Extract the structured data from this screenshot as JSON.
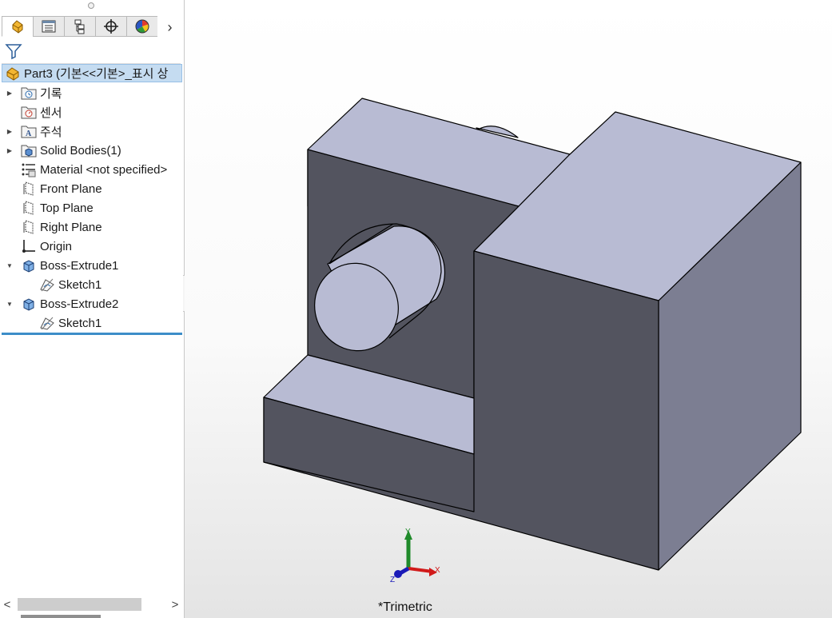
{
  "panel": {
    "tabs": [
      {
        "name": "featuremanager-tab-icon",
        "active": true
      },
      {
        "name": "propertymanager-tab-icon",
        "active": false
      },
      {
        "name": "configurationmanager-tab-icon",
        "active": false
      },
      {
        "name": "dimxpert-tab-icon",
        "active": false
      },
      {
        "name": "display-manager-tab-icon",
        "active": false
      }
    ],
    "more_tabs_glyph": "›",
    "filter_icon": "filter-icon",
    "root": {
      "label": "Part3  (기본<<기본>_표시 상",
      "icon": "part-icon"
    },
    "tree": [
      {
        "label": "기록",
        "icon": "history-icon",
        "expandable": true
      },
      {
        "label": "센서",
        "icon": "sensors-icon",
        "expandable": false
      },
      {
        "label": "주석",
        "icon": "annotations-icon",
        "expandable": true
      },
      {
        "label": "Solid Bodies(1)",
        "icon": "solid-bodies-icon",
        "expandable": true
      },
      {
        "label": "Material <not specified>",
        "icon": "material-icon",
        "expandable": false
      },
      {
        "label": "Front Plane",
        "icon": "plane-icon",
        "expandable": false
      },
      {
        "label": "Top Plane",
        "icon": "plane-icon",
        "expandable": false
      },
      {
        "label": "Right Plane",
        "icon": "plane-icon",
        "expandable": false
      },
      {
        "label": "Origin",
        "icon": "origin-icon",
        "expandable": false
      },
      {
        "label": "Boss-Extrude1",
        "icon": "boss-extrude-icon",
        "expandable": true,
        "expanded": true
      },
      {
        "label": "Sketch1",
        "icon": "sketch-icon",
        "child": true
      },
      {
        "label": "Boss-Extrude2",
        "icon": "boss-extrude-icon",
        "expandable": true,
        "expanded": true
      },
      {
        "label": "Sketch1",
        "icon": "sketch-icon",
        "child": true
      }
    ],
    "scroll": {
      "left_glyph": "<",
      "right_glyph": ">"
    }
  },
  "viewport": {
    "view_orientation": "*Trimetric",
    "triad": {
      "x_label": "X",
      "y_label": "Y",
      "z_label": "Z"
    },
    "colors": {
      "face_top": "#b8bbd3",
      "face_front": "#53545f",
      "face_side": "#7c7e92",
      "edge": "#000000",
      "triad_x": "#d11a1a",
      "triad_y": "#1f8a2a",
      "triad_z": "#1a1ab8"
    }
  }
}
